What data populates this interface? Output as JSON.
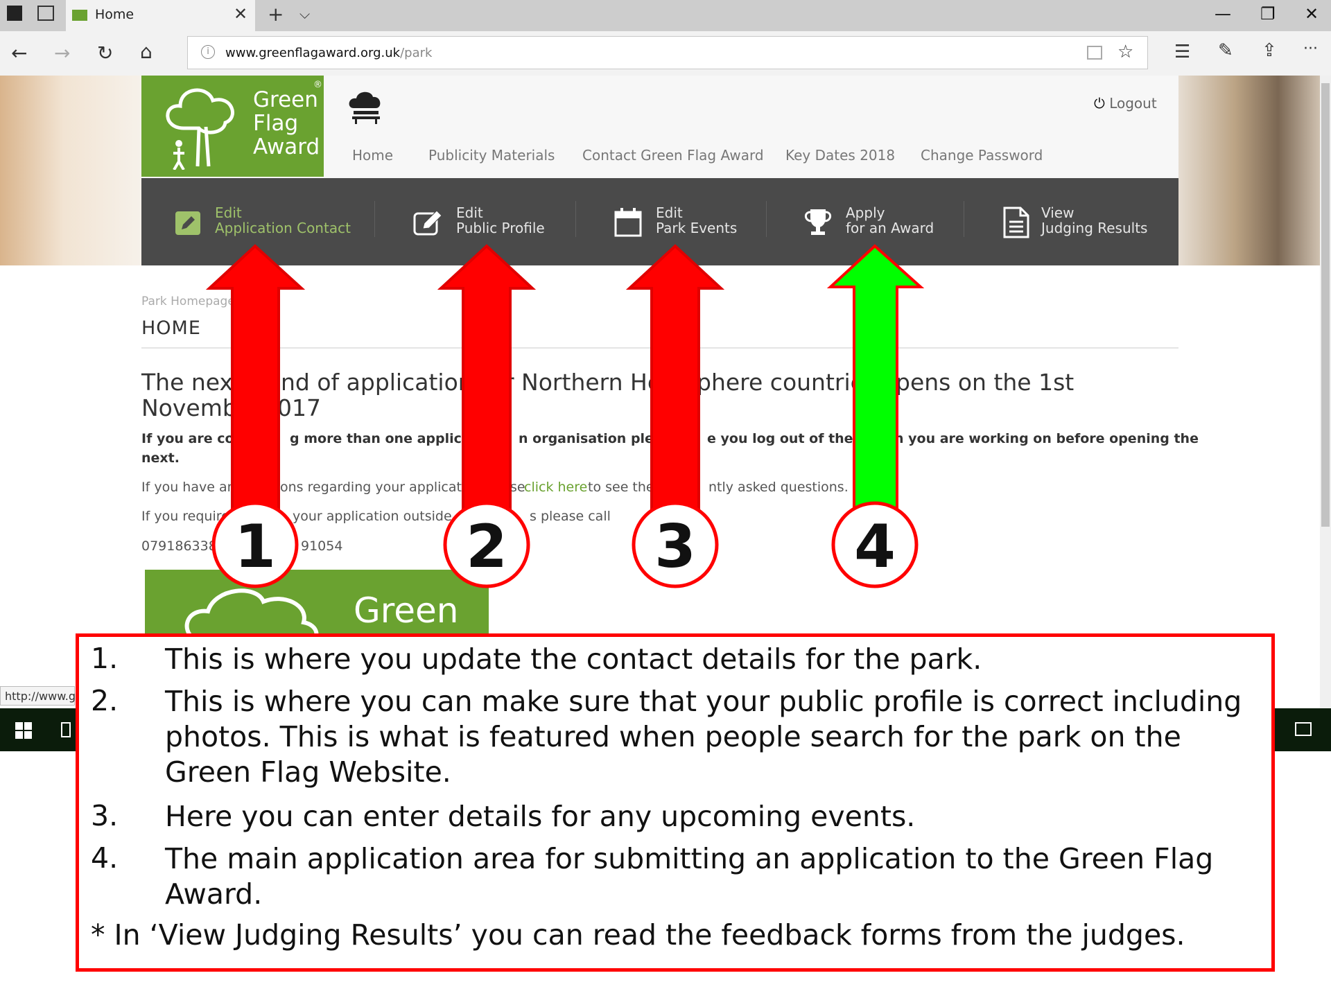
{
  "browser": {
    "tab_title": "Home",
    "tab_close": "✕",
    "new_tab": "+",
    "tab_dropdown": "⌵",
    "window_controls": {
      "minimize": "—",
      "restore": "❐",
      "close": "✕"
    },
    "url_domain": "www.greenflagaward.org.uk",
    "url_path": "/park",
    "more_menu": "···"
  },
  "site": {
    "logo_lines": [
      "Green",
      "Flag",
      "Award"
    ],
    "logo_mark": "®",
    "logout": "Logout",
    "nav": [
      "Home",
      "Publicity Materials",
      "Contact Green Flag Award",
      "Key Dates 2018",
      "Change Password"
    ],
    "actions": [
      {
        "line1": "Edit",
        "line2": "Application Contact",
        "icon": "pencil-square-icon"
      },
      {
        "line1": "Edit",
        "line2": "Public Profile",
        "icon": "edit-icon"
      },
      {
        "line1": "Edit",
        "line2": "Park Events",
        "icon": "calendar-icon"
      },
      {
        "line1": "Apply",
        "line2": "for an Award",
        "icon": "trophy-icon"
      },
      {
        "line1": "View",
        "line2": "Judging Results",
        "icon": "document-icon"
      }
    ]
  },
  "content": {
    "breadcrumb": "Park Homepage",
    "title": "HOME",
    "headline_1": "The next",
    "headline_2": "nd of application",
    "headline_3": "r Northern He",
    "headline_4": "phere countrie",
    "headline_5": "pens on the 1st",
    "headline_6": "Novemb",
    "headline_7": "017",
    "bold_1": "If you are com",
    "bold_2": "g more than one applicatio",
    "bold_3": "n organisation please",
    "bold_4": "e you log out of the app",
    "bold_5": "n you are working on before opening the",
    "bold_6": "next.",
    "q_1": "If you have any",
    "q_2": "ons regarding your applicatio",
    "q_3": "se",
    "q_link": "click here",
    "q_4": "to see the",
    "q_5": "ntly asked questions.",
    "r_1": "If you require",
    "r_2": "your application outside",
    "r_3": "s please call",
    "phone_1": "0791863389",
    "phone_2": "91054",
    "bottom_logo_word": "Green",
    "status_url": "http://www.g"
  },
  "annotations": {
    "badges": [
      "1",
      "2",
      "3",
      "4"
    ],
    "colors": {
      "red_arrow": "#ff0000",
      "green_arrow": "#00ff00",
      "callout_border": "#ff0000"
    },
    "callout_items": [
      {
        "num": "1.",
        "text": "This is where you update the contact details for the park."
      },
      {
        "num": "2.",
        "text": "This is where you can make sure that your public profile is correct including photos. This is what is featured when people search for the park on the Green Flag Website."
      },
      {
        "num": "3.",
        "text": "Here you can enter details for any upcoming events."
      },
      {
        "num": "4.",
        "text": "The main application area for submitting an application to the Green Flag Award."
      }
    ],
    "note": "* In ‘View Judging Results’ you can read the feedback forms from the judges."
  }
}
